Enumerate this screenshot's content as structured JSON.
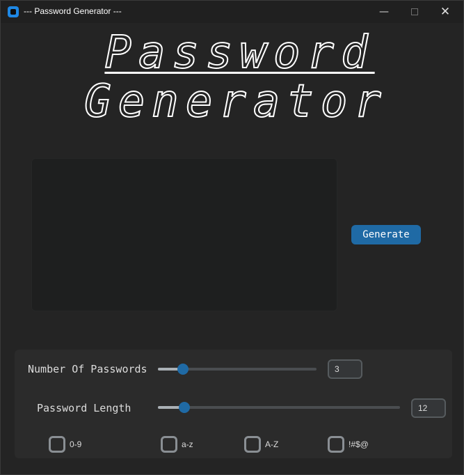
{
  "window": {
    "title": "--- Password Generator ---",
    "minimize_glyph": "—",
    "close_glyph": "✕"
  },
  "hero": {
    "line1": "Password",
    "line2": "Generator"
  },
  "output": {
    "value": ""
  },
  "generate": {
    "label": "Generate"
  },
  "options": {
    "count": {
      "label": "Number Of Passwords",
      "value": "3",
      "slider_fraction": 0.16
    },
    "length": {
      "label": "Password Length",
      "value": "12",
      "slider_fraction": 0.11
    },
    "checkboxes": [
      {
        "label": "0-9",
        "checked": false
      },
      {
        "label": "a-z",
        "checked": false
      },
      {
        "label": "A-Z",
        "checked": false
      },
      {
        "label": "!#$@",
        "checked": false
      }
    ]
  },
  "colors": {
    "accent": "#1f6aa5",
    "window_bg": "#242424",
    "panel_bg": "#2b2b2b",
    "output_bg": "#1e1f1f"
  },
  "icons": {
    "app": "app-icon",
    "minimize": "minimize-icon",
    "maximize": "maximize-icon",
    "close": "close-icon"
  }
}
